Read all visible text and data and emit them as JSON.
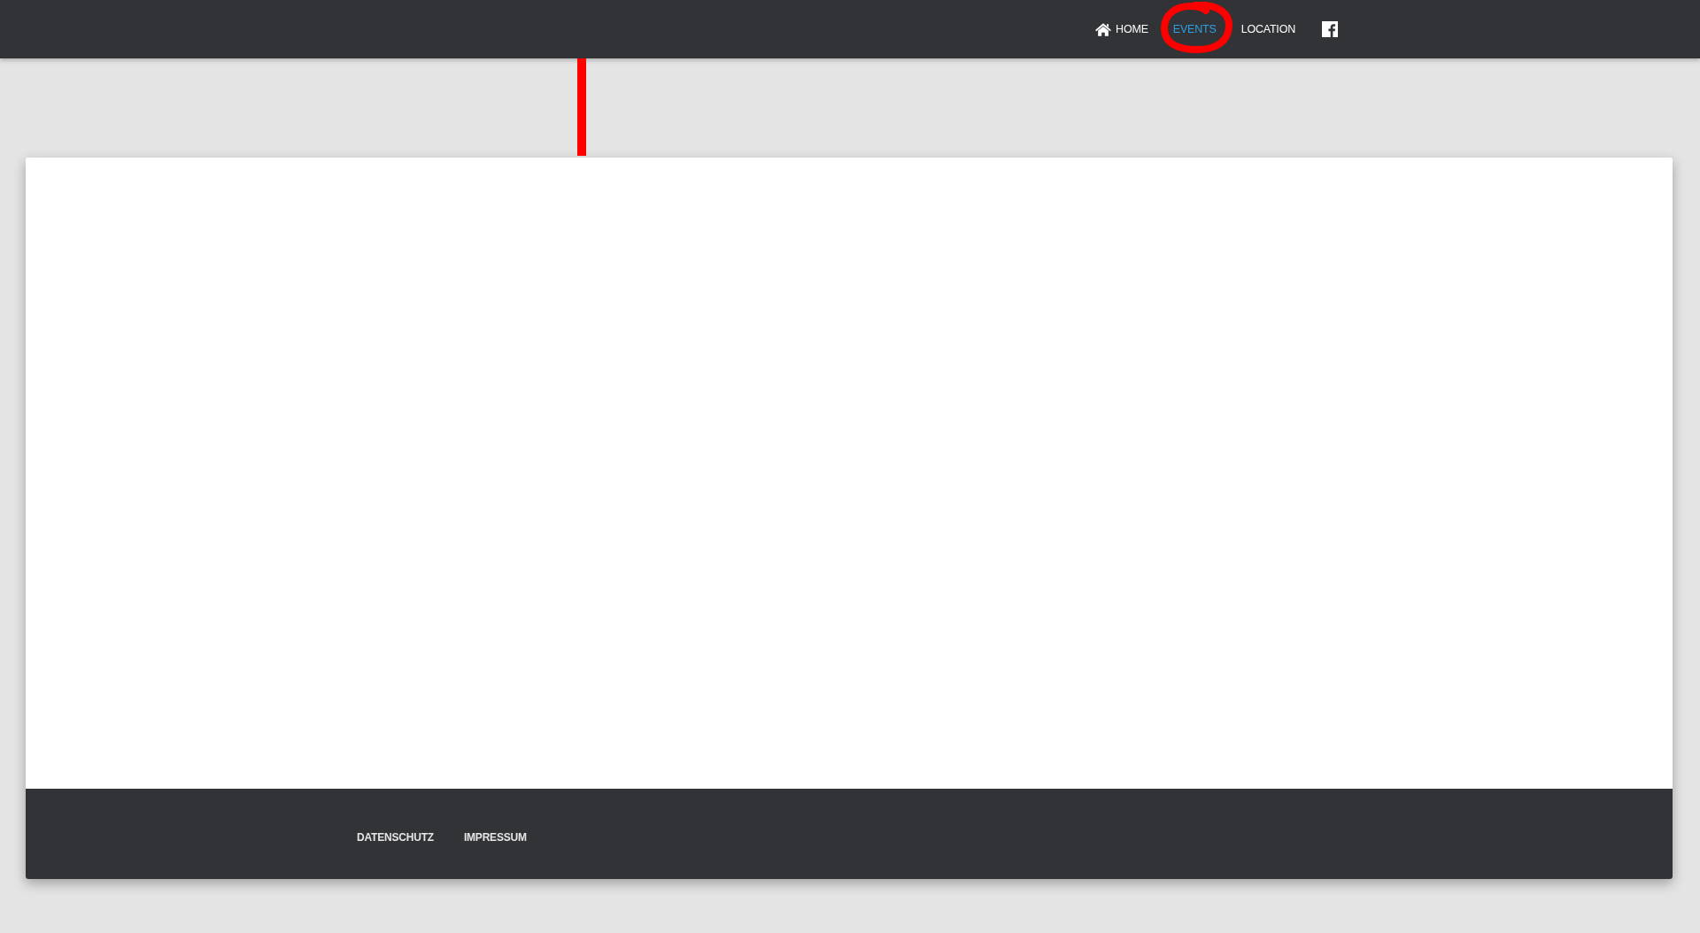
{
  "nav": {
    "items": [
      {
        "kind": "with-icon",
        "label": "HOME",
        "selected": false,
        "circled": false
      },
      {
        "kind": "plain",
        "label": "EVENTS",
        "selected": true,
        "circled": true
      },
      {
        "kind": "plain",
        "label": "LOCATION",
        "selected": false,
        "circled": false
      }
    ]
  },
  "footer": {
    "links": [
      "DATENSCHUTZ",
      "IMPRESSUM"
    ]
  }
}
